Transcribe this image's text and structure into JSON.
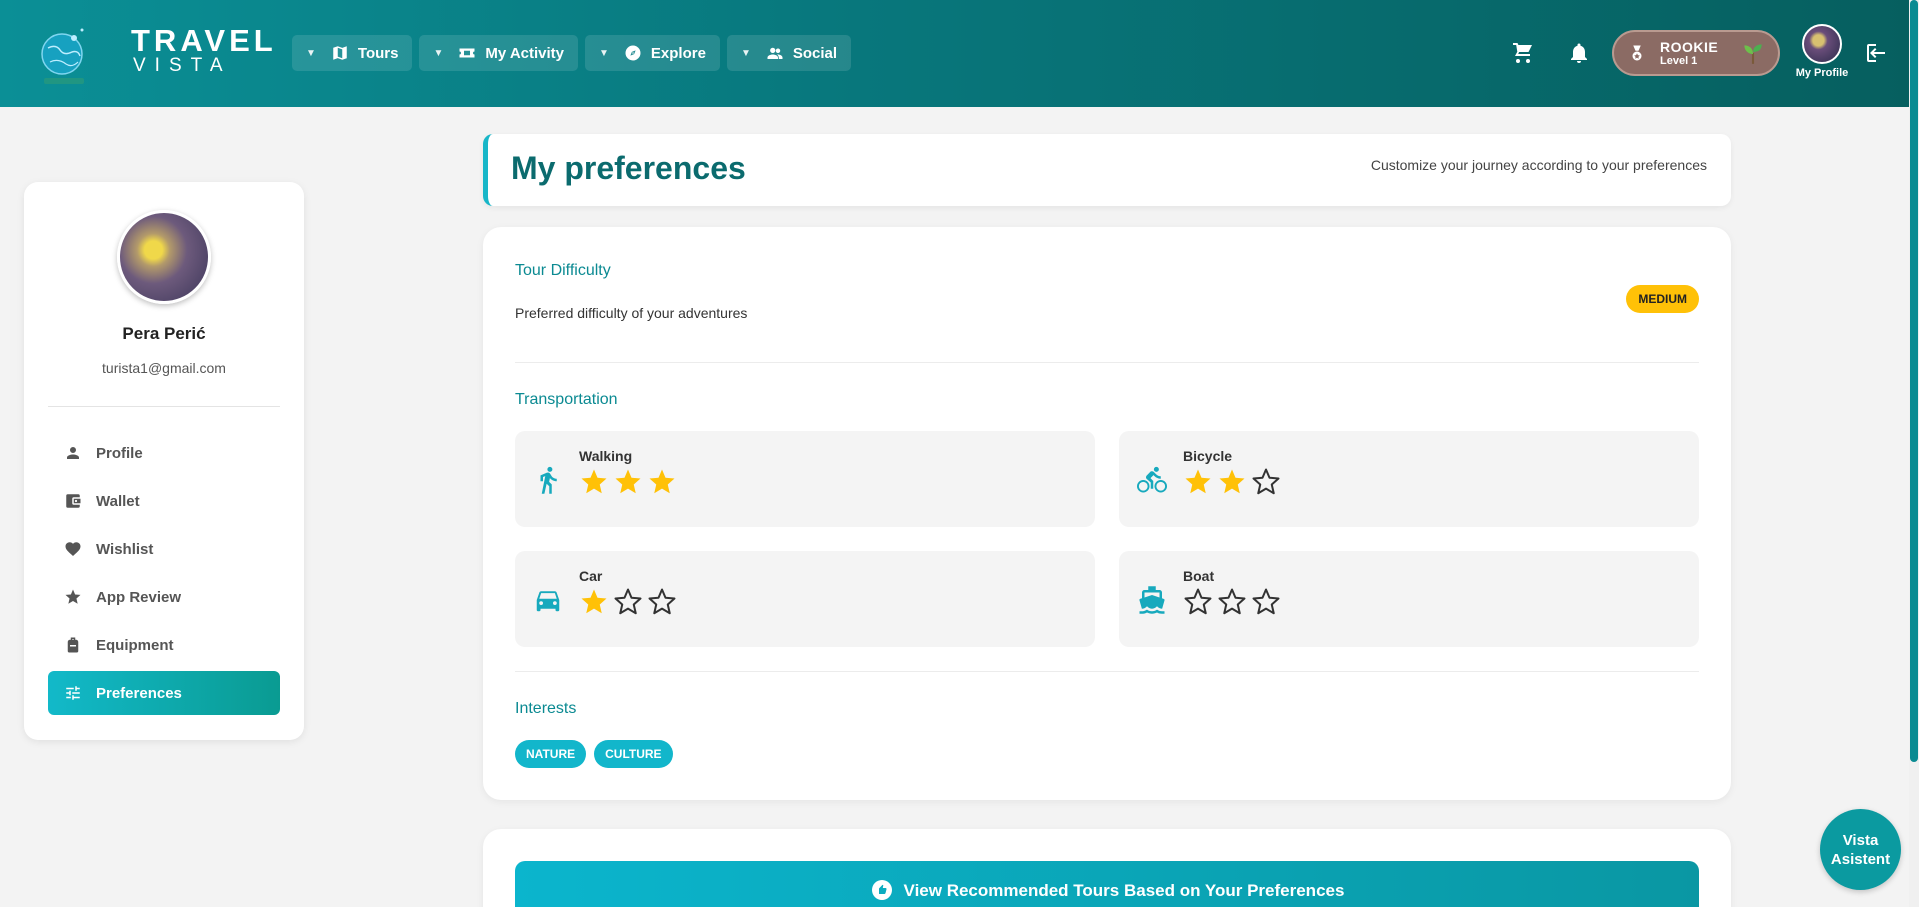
{
  "brand": {
    "line1": "TRAVEL",
    "line2": "VISTA"
  },
  "nav": [
    {
      "label": "Tours",
      "icon": "map-icon"
    },
    {
      "label": "My Activity",
      "icon": "ticket-icon"
    },
    {
      "label": "Explore",
      "icon": "compass-icon"
    },
    {
      "label": "Social",
      "icon": "people-icon"
    }
  ],
  "header": {
    "rank_title": "ROOKIE",
    "rank_level": "Level 1",
    "profile_label": "My Profile"
  },
  "user": {
    "name": "Pera Perić",
    "email": "turista1@gmail.com"
  },
  "sidebar": {
    "items": [
      {
        "label": "Profile",
        "icon": "person-icon"
      },
      {
        "label": "Wallet",
        "icon": "wallet-icon"
      },
      {
        "label": "Wishlist",
        "icon": "heart-icon"
      },
      {
        "label": "App Review",
        "icon": "star-icon"
      },
      {
        "label": "Equipment",
        "icon": "backpack-icon"
      },
      {
        "label": "Preferences",
        "icon": "sliders-icon",
        "active": true
      }
    ]
  },
  "page": {
    "title": "My preferences",
    "subtitle": "Customize your journey according to your preferences"
  },
  "difficulty": {
    "title": "Tour Difficulty",
    "description": "Preferred difficulty of your adventures",
    "value": "MEDIUM"
  },
  "transportation": {
    "title": "Transportation",
    "items": [
      {
        "name": "Walking",
        "rating": 3,
        "icon": "walking-icon"
      },
      {
        "name": "Bicycle",
        "rating": 2,
        "icon": "bicycle-icon"
      },
      {
        "name": "Car",
        "rating": 1,
        "icon": "car-icon"
      },
      {
        "name": "Boat",
        "rating": 0,
        "icon": "boat-icon"
      }
    ],
    "max_rating": 5
  },
  "interests": {
    "title": "Interests",
    "tags": [
      "NATURE",
      "CULTURE"
    ]
  },
  "recommend_button": "View Recommended Tours Based on Your Preferences",
  "assistant": {
    "line1": "Vista",
    "line2": "Asistent"
  },
  "colors": {
    "accent": "#12b6cb",
    "teal_dark": "#0b6b6e",
    "star": "#ffc107",
    "badge": "#ffc107"
  }
}
